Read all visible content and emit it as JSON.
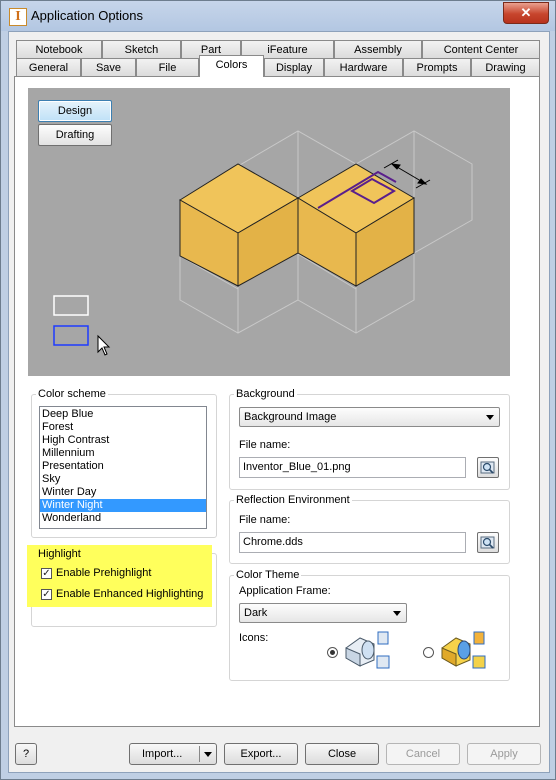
{
  "window": {
    "title": "Application Options",
    "close_glyph": "✕",
    "app_icon_letter": "I"
  },
  "tabs_row1": [
    "Notebook",
    "Sketch",
    "Part",
    "iFeature",
    "Assembly",
    "Content Center"
  ],
  "tabs_row2": [
    "General",
    "Save",
    "File",
    "Colors",
    "Display",
    "Hardware",
    "Prompts",
    "Drawing"
  ],
  "active_tab": "Colors",
  "preview": {
    "design_label": "Design",
    "drafting_label": "Drafting"
  },
  "color_scheme": {
    "label": "Color scheme",
    "items": [
      "Deep Blue",
      "Forest",
      "High Contrast",
      "Millennium",
      "Presentation",
      "Sky",
      "Winter Day",
      "Winter Night",
      "Wonderland"
    ],
    "selected": "Winter Night"
  },
  "highlight": {
    "label": "Highlight",
    "prehighlight_label": "Enable Prehighlight",
    "prehighlight_checked": true,
    "enhanced_label": "Enable Enhanced Highlighting",
    "enhanced_checked": true
  },
  "background": {
    "label": "Background",
    "type_value": "Background Image",
    "file_label": "File name:",
    "file_value": "Inventor_Blue_01.png"
  },
  "reflection": {
    "label": "Reflection Environment",
    "file_label": "File name:",
    "file_value": "Chrome.dds"
  },
  "color_theme": {
    "label": "Color Theme",
    "frame_label": "Application Frame:",
    "frame_value": "Dark",
    "icons_label": "Icons:",
    "icons_selected": "first"
  },
  "buttons": {
    "help": "?",
    "import": "Import...",
    "export": "Export...",
    "close": "Close",
    "cancel": "Cancel",
    "apply": "Apply"
  },
  "colors": {
    "cube_face": "#f0c45a",
    "highlight_yellow": "#ffff5c",
    "selection_blue": "#3399ff",
    "preselect_purple": "#5a1f8c"
  }
}
